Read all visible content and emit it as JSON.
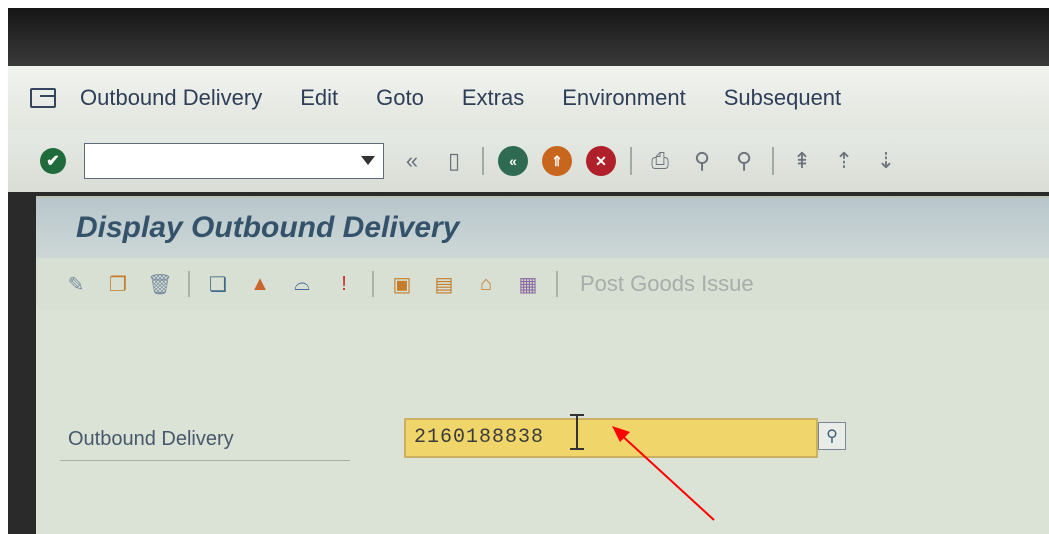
{
  "menubar": {
    "items": [
      {
        "label": "Outbound Delivery"
      },
      {
        "label": "Edit"
      },
      {
        "label": "Goto"
      },
      {
        "label": "Extras"
      },
      {
        "label": "Environment"
      },
      {
        "label": "Subsequent"
      }
    ]
  },
  "toolbar": {
    "command_value": "",
    "icons": [
      "enter-check-icon",
      "back-icon",
      "save-icon",
      "green-back-icon",
      "exit-icon",
      "cancel-icon",
      "print-icon",
      "find-icon",
      "find-next-icon",
      "first-page-icon",
      "prev-page-icon",
      "next-page-icon"
    ]
  },
  "screen": {
    "title": "Display Outbound Delivery",
    "app_toolbar": {
      "icons": [
        "display-change-icon",
        "create-icon",
        "delete-icon",
        "copy-icon",
        "mountain-icon",
        "hat-icon",
        "alert-icon",
        "box-icon",
        "doc-icon",
        "house-icon",
        "table-icon"
      ],
      "post_goods_issue": "Post Goods Issue"
    },
    "field": {
      "label": "Outbound Delivery",
      "value": "2160188838"
    }
  },
  "annotation": {
    "arrow_color": "#ff0000"
  }
}
